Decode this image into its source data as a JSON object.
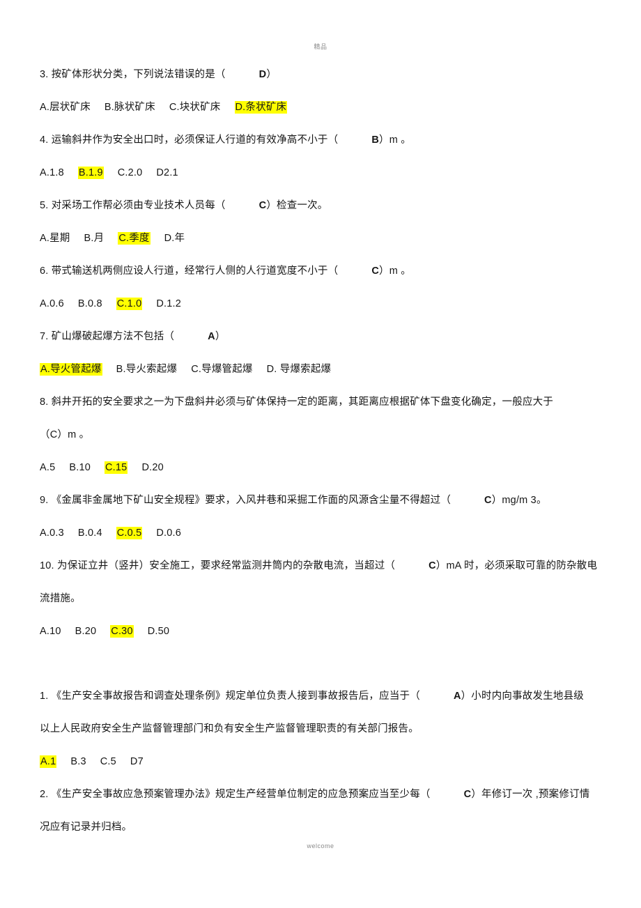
{
  "page": {
    "header_watermark": "精品",
    "footer_watermark": "welcome",
    "highlight_color": "#ffff00",
    "text_color": "#161616",
    "background_color": "#ffffff"
  },
  "questions": [
    {
      "id": "q3",
      "number": "3.",
      "stem_prefix": "按矿体形状分类，下列说法错误的是（",
      "answer": "D",
      "stem_suffix": "）",
      "stem_lines": [],
      "options": [
        {
          "label": "A.层状矿床",
          "highlighted": false
        },
        {
          "label": "B.脉状矿床",
          "highlighted": false
        },
        {
          "label": "C.块状矿床",
          "highlighted": false
        },
        {
          "label": "D.条状矿床",
          "highlighted": true
        }
      ]
    },
    {
      "id": "q4",
      "number": "4.",
      "stem_prefix": "运输斜井作为安全出口时，必须保证人行道的有效净高不小于（",
      "answer": "B",
      "stem_suffix": "）m 。",
      "stem_lines": [],
      "options": [
        {
          "label": "A.1.8",
          "highlighted": false
        },
        {
          "label": "B.1.9",
          "highlighted": true
        },
        {
          "label": "C.2.0",
          "highlighted": false
        },
        {
          "label": "D2.1",
          "highlighted": false
        }
      ]
    },
    {
      "id": "q5",
      "number": "5.",
      "stem_prefix": "对采场工作帮必须由专业技术人员每（",
      "answer": "C",
      "stem_suffix": "）检查一次。",
      "stem_lines": [],
      "options": [
        {
          "label": "A.星期",
          "highlighted": false
        },
        {
          "label": "B.月",
          "highlighted": false
        },
        {
          "label": "C.季度",
          "highlighted": true
        },
        {
          "label": "D.年",
          "highlighted": false
        }
      ]
    },
    {
      "id": "q6",
      "number": "6.",
      "stem_prefix": "带式输送机两侧应设人行道，经常行人侧的人行道宽度不小于（",
      "answer": "C",
      "stem_suffix": "）m 。",
      "stem_lines": [],
      "options": [
        {
          "label": "A.0.6",
          "highlighted": false
        },
        {
          "label": "B.0.8",
          "highlighted": false
        },
        {
          "label": "C.1.0",
          "highlighted": true
        },
        {
          "label": "D.1.2",
          "highlighted": false
        }
      ]
    },
    {
      "id": "q7",
      "number": "7.",
      "stem_prefix": "矿山爆破起爆方法不包括（",
      "answer": "A",
      "stem_suffix": "）",
      "stem_lines": [],
      "options": [
        {
          "label": "A.导火管起爆",
          "highlighted": true
        },
        {
          "label": "B.导火索起爆",
          "highlighted": false
        },
        {
          "label": "C.导爆管起爆",
          "highlighted": false
        },
        {
          "label": "D. 导爆索起爆",
          "highlighted": false
        }
      ]
    },
    {
      "id": "q8",
      "number": "8.",
      "stem_prefix": "斜井开拓的安全要求之一为下盘斜井必须与矿体保持一定的距离，其距离应根据矿体下盘变化确定，一般应大于",
      "answer": "",
      "stem_suffix": "",
      "stem_lines": [
        "（C）m 。"
      ],
      "options": [
        {
          "label": "A.5",
          "highlighted": false
        },
        {
          "label": "B.10",
          "highlighted": false
        },
        {
          "label": "C.15",
          "highlighted": true
        },
        {
          "label": "D.20",
          "highlighted": false
        }
      ]
    },
    {
      "id": "q9",
      "number": "9.",
      "stem_prefix": "《金属非金属地下矿山安全规程》要求，入风井巷和采掘工作面的风源含尘量不得超过（",
      "answer": "C",
      "stem_suffix": "）mg/m 3。",
      "stem_lines": [],
      "options": [
        {
          "label": "A.0.3",
          "highlighted": false
        },
        {
          "label": "B.0.4",
          "highlighted": false
        },
        {
          "label": "C.0.5",
          "highlighted": true
        },
        {
          "label": "D.0.6",
          "highlighted": false
        }
      ]
    },
    {
      "id": "q10",
      "number": "10.",
      "stem_prefix": "为保证立井（竖井）安全施工，要求经常监测井筒内的杂散电流，当超过（",
      "answer": "C",
      "stem_suffix": "）mA 时，必须采取可靠的防杂散电",
      "stem_lines": [
        "流措施。"
      ],
      "options": [
        {
          "label": "A.10",
          "highlighted": false
        },
        {
          "label": "B.20",
          "highlighted": false
        },
        {
          "label": "C.30",
          "highlighted": true
        },
        {
          "label": "D.50",
          "highlighted": false
        }
      ]
    }
  ],
  "questions_group2": [
    {
      "id": "g2q1",
      "number": "1.",
      "stem_prefix": "《生产安全事故报告和调查处理条例》规定单位负责人接到事故报告后，应当于（",
      "answer": "A",
      "stem_suffix": "）小时内向事故发生地县级",
      "stem_lines": [
        "以上人民政府安全生产监督管理部门和负有安全生产监督管理职责的有关部门报告。"
      ],
      "options": [
        {
          "label": "A.1",
          "highlighted": true
        },
        {
          "label": "B.3",
          "highlighted": false
        },
        {
          "label": "C.5",
          "highlighted": false
        },
        {
          "label": "D7",
          "highlighted": false
        }
      ]
    },
    {
      "id": "g2q2",
      "number": "2.",
      "stem_prefix": "《生产安全事故应急预案管理办法》规定生产经营单位制定的应急预案应当至少每（",
      "answer": "C",
      "stem_suffix": "）年修订一次 ,预案修订情",
      "stem_lines": [
        "况应有记录并归档。"
      ],
      "options": []
    }
  ]
}
